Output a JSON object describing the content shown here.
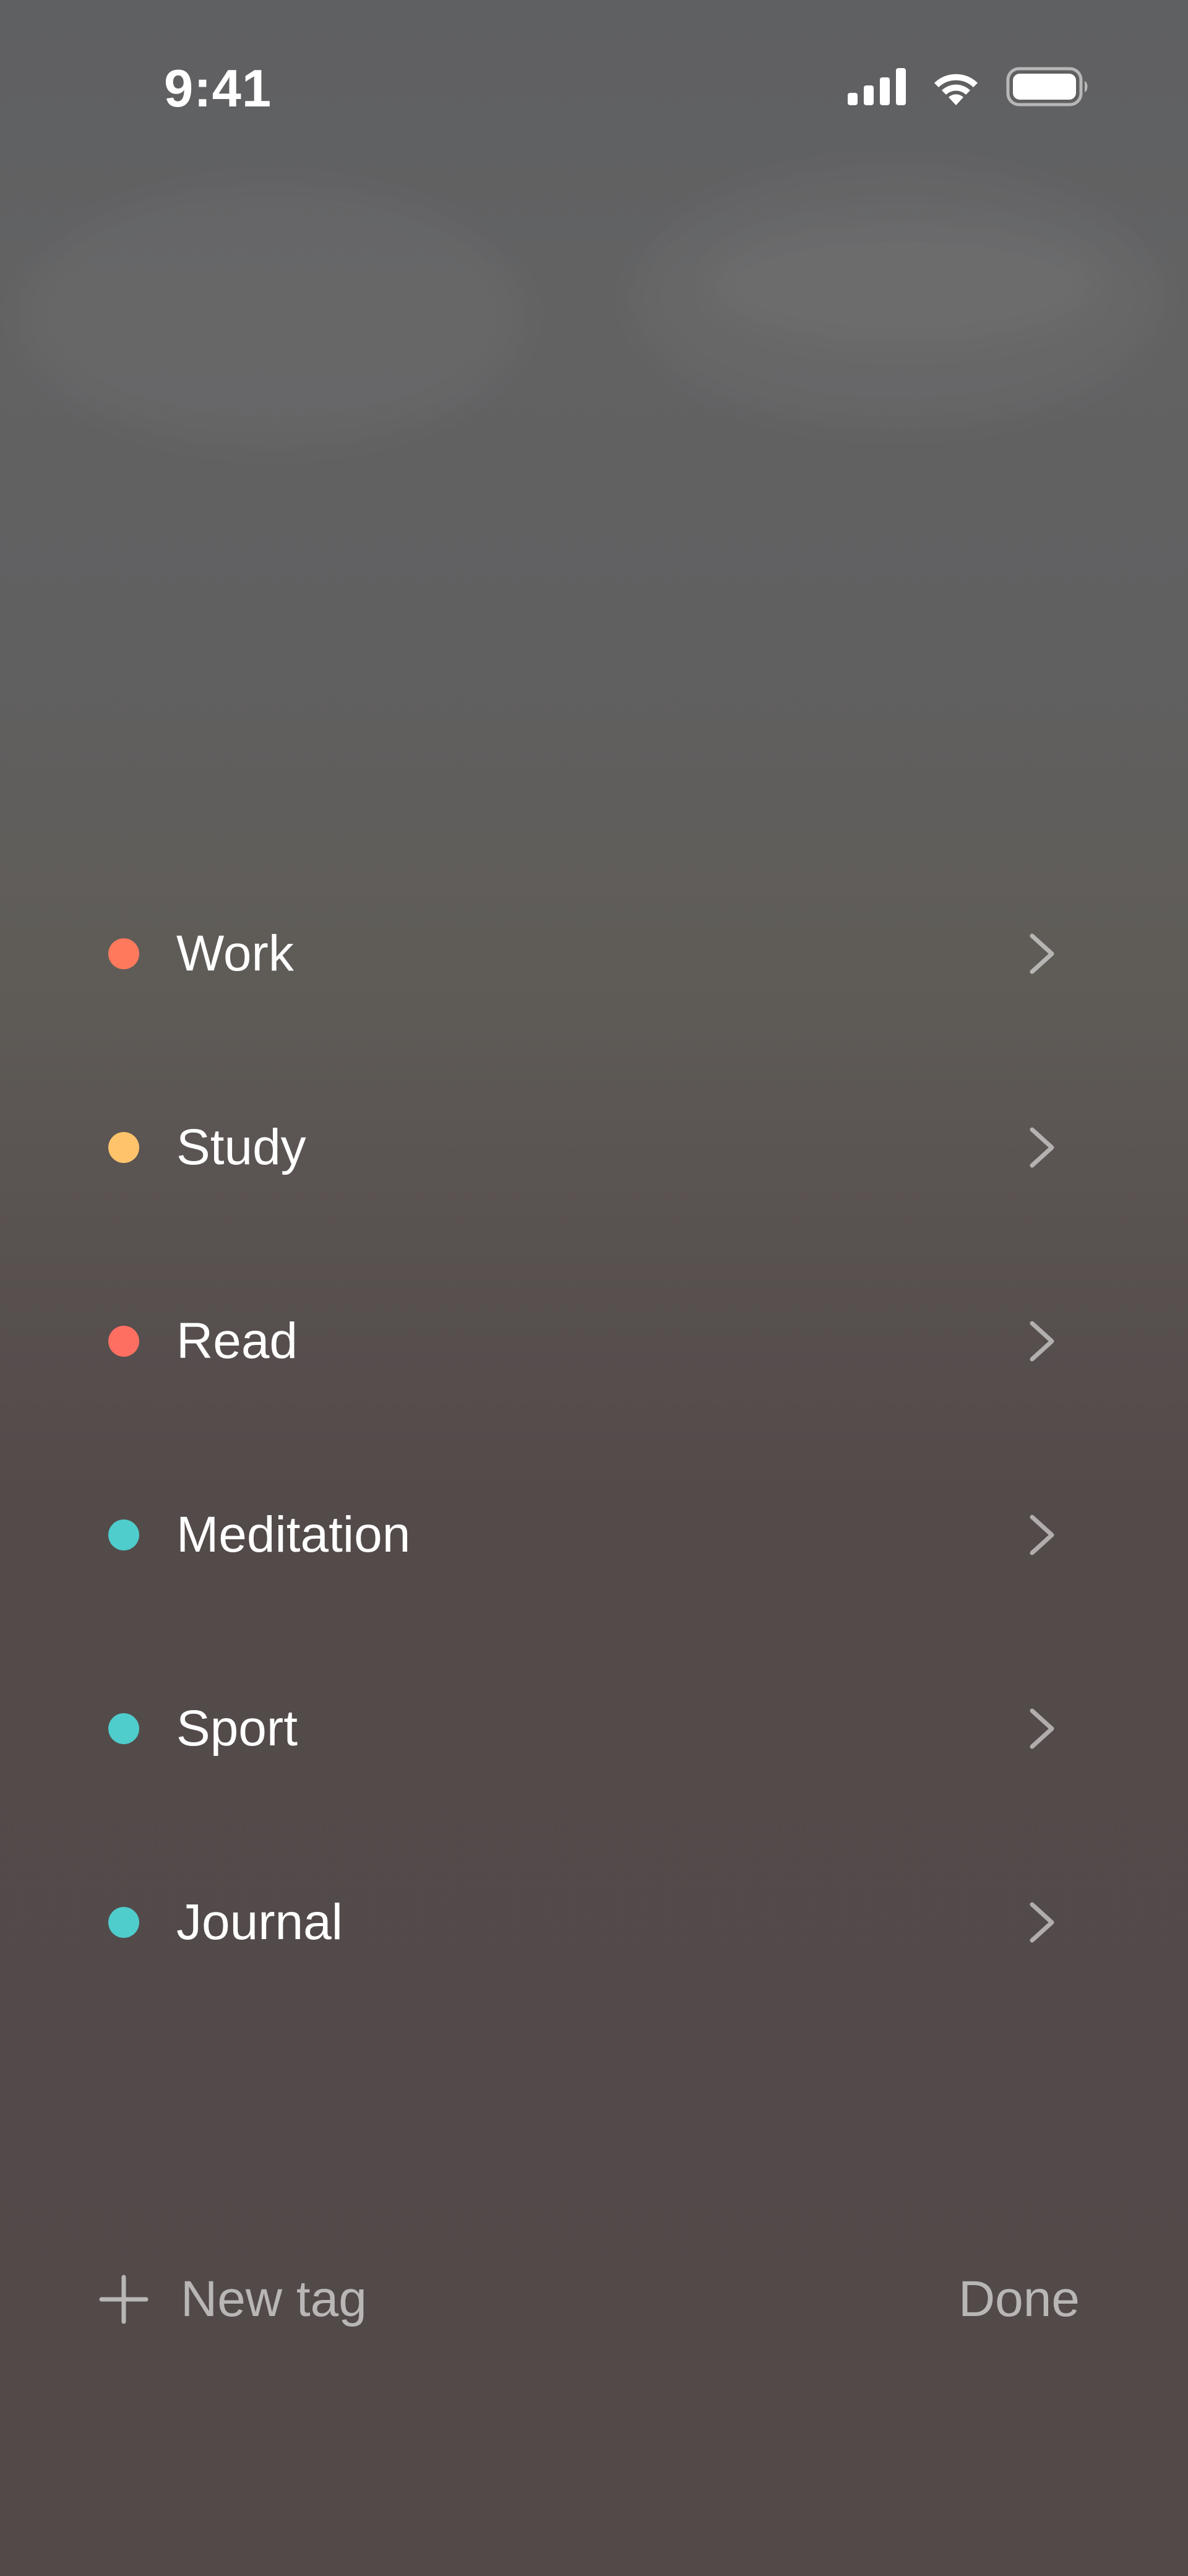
{
  "status_bar": {
    "time": "9:41",
    "icons": [
      "cellular-signal-icon",
      "wifi-icon",
      "battery-icon"
    ]
  },
  "tags": [
    {
      "label": "Work",
      "color": "#ff7a5c"
    },
    {
      "label": "Study",
      "color": "#ffc46b"
    },
    {
      "label": "Read",
      "color": "#ff6f61"
    },
    {
      "label": "Meditation",
      "color": "#4fcccc"
    },
    {
      "label": "Sport",
      "color": "#4fcccc"
    },
    {
      "label": "Journal",
      "color": "#4fcccc"
    }
  ],
  "footer": {
    "new_tag_label": "New tag",
    "done_label": "Done"
  }
}
